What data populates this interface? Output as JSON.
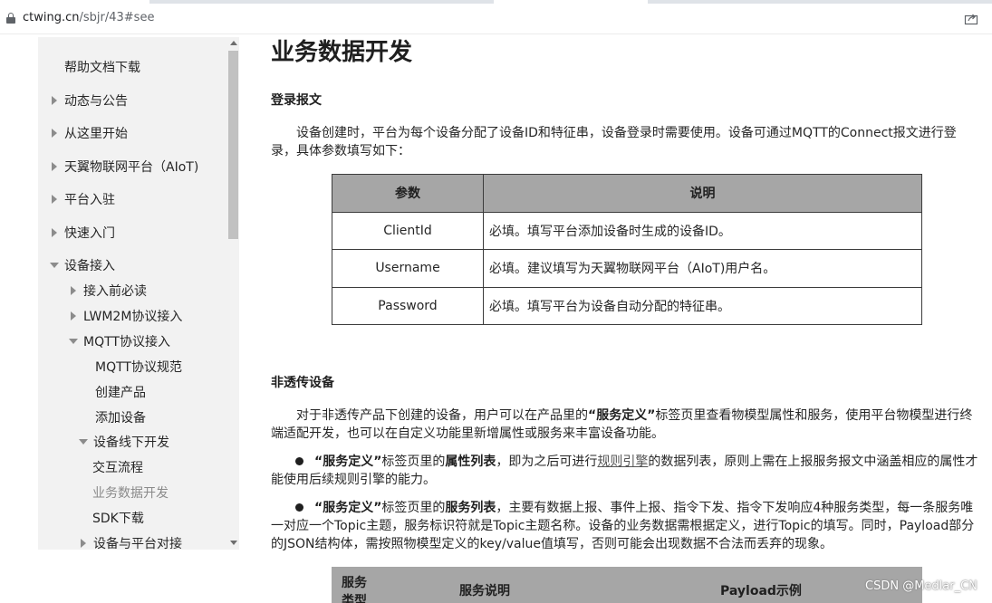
{
  "browser": {
    "url_host": "ctwing.cn",
    "url_path": "/sbjr/43#see"
  },
  "sidebar": {
    "items": [
      {
        "label": "帮助文档下载",
        "expander": "none"
      },
      {
        "label": "动态与公告",
        "expander": "collapsed"
      },
      {
        "label": "从这里开始",
        "expander": "collapsed"
      },
      {
        "label": "天翼物联网平台（AIoT)",
        "expander": "collapsed"
      },
      {
        "label": "平台入驻",
        "expander": "collapsed"
      },
      {
        "label": "快速入门",
        "expander": "collapsed"
      },
      {
        "label": "设备接入",
        "expander": "expanded"
      },
      {
        "label": "接入前必读",
        "expander": "collapsed"
      },
      {
        "label": "LWM2M协议接入",
        "expander": "collapsed"
      },
      {
        "label": "MQTT协议接入",
        "expander": "expanded"
      },
      {
        "label": "MQTT协议规范",
        "expander": "none"
      },
      {
        "label": "创建产品",
        "expander": "none"
      },
      {
        "label": "添加设备",
        "expander": "none"
      },
      {
        "label": "设备线下开发",
        "expander": "expanded"
      },
      {
        "label": "交互流程",
        "expander": "none"
      },
      {
        "label": "业务数据开发",
        "expander": "none",
        "state": "current"
      },
      {
        "label": "SDK下载",
        "expander": "none"
      },
      {
        "label": "设备与平台对接",
        "expander": "collapsed"
      }
    ]
  },
  "main": {
    "title": "业务数据开发",
    "login_heading": "登录报文",
    "login_para": "设备创建时，平台为每个设备分配了设备ID和特征串，设备登录时需要使用。设备可通过MQTT的Connect报文进行登录，具体参数填写如下：",
    "params_table": {
      "headers": [
        "参数",
        "说明"
      ],
      "rows": [
        [
          "ClientId",
          "必填。填写平台添加设备时生成的设备ID。"
        ],
        [
          "Username",
          "必填。建议填写为天翼物联网平台（AIoT)用户名。"
        ],
        [
          "Password",
          "必填。填写平台为设备自动分配的特征串。"
        ]
      ]
    },
    "nontransparent_heading": "非透传设备",
    "nontransparent_para": {
      "pre": "对于非透传产品下创建的设备，用户可以在产品里的",
      "bold": "“服务定义”",
      "post": "标签页里查看物模型属性和服务，使用平台物模型进行终端适配开发，也可以在自定义功能里新增属性或服务来丰富设备功能。"
    },
    "bullet1": {
      "b1": "“服务定义”",
      "t1": "标签页里的",
      "b2": "属性列表",
      "t2": "，即为之后可进行",
      "link": "规则引擎",
      "t3": "的数据列表，原则上需在上报服务报文中涵盖相应的属性才能使用后续规则引擎的能力。"
    },
    "bullet2": {
      "b1": "“服务定义”",
      "t1": "标签页里的",
      "b2": "服务列表",
      "t2": "，主要有数据上报、事件上报、指令下发、指令下发响应4种服务类型，每一条服务唯一对应一个Topic主题，服务标识符就是Topic主题名称。设备的业务数据需根据定义，进行Topic的填写。同时，Payload部分的JSON结构体，需按照物模型定义的key/value值填写，否则可能会出现数据不合法而丢弃的现象。"
    },
    "service_table": {
      "headers": [
        "服务类型",
        "服务说明",
        "Payload示例"
      ]
    }
  },
  "watermark": "CSDN @Medlar_CN",
  "colors": {
    "sidebar_bg": "#f2f2f2",
    "table_header_bg": "#a6a6a6",
    "current_item": "#8a8a8a"
  }
}
